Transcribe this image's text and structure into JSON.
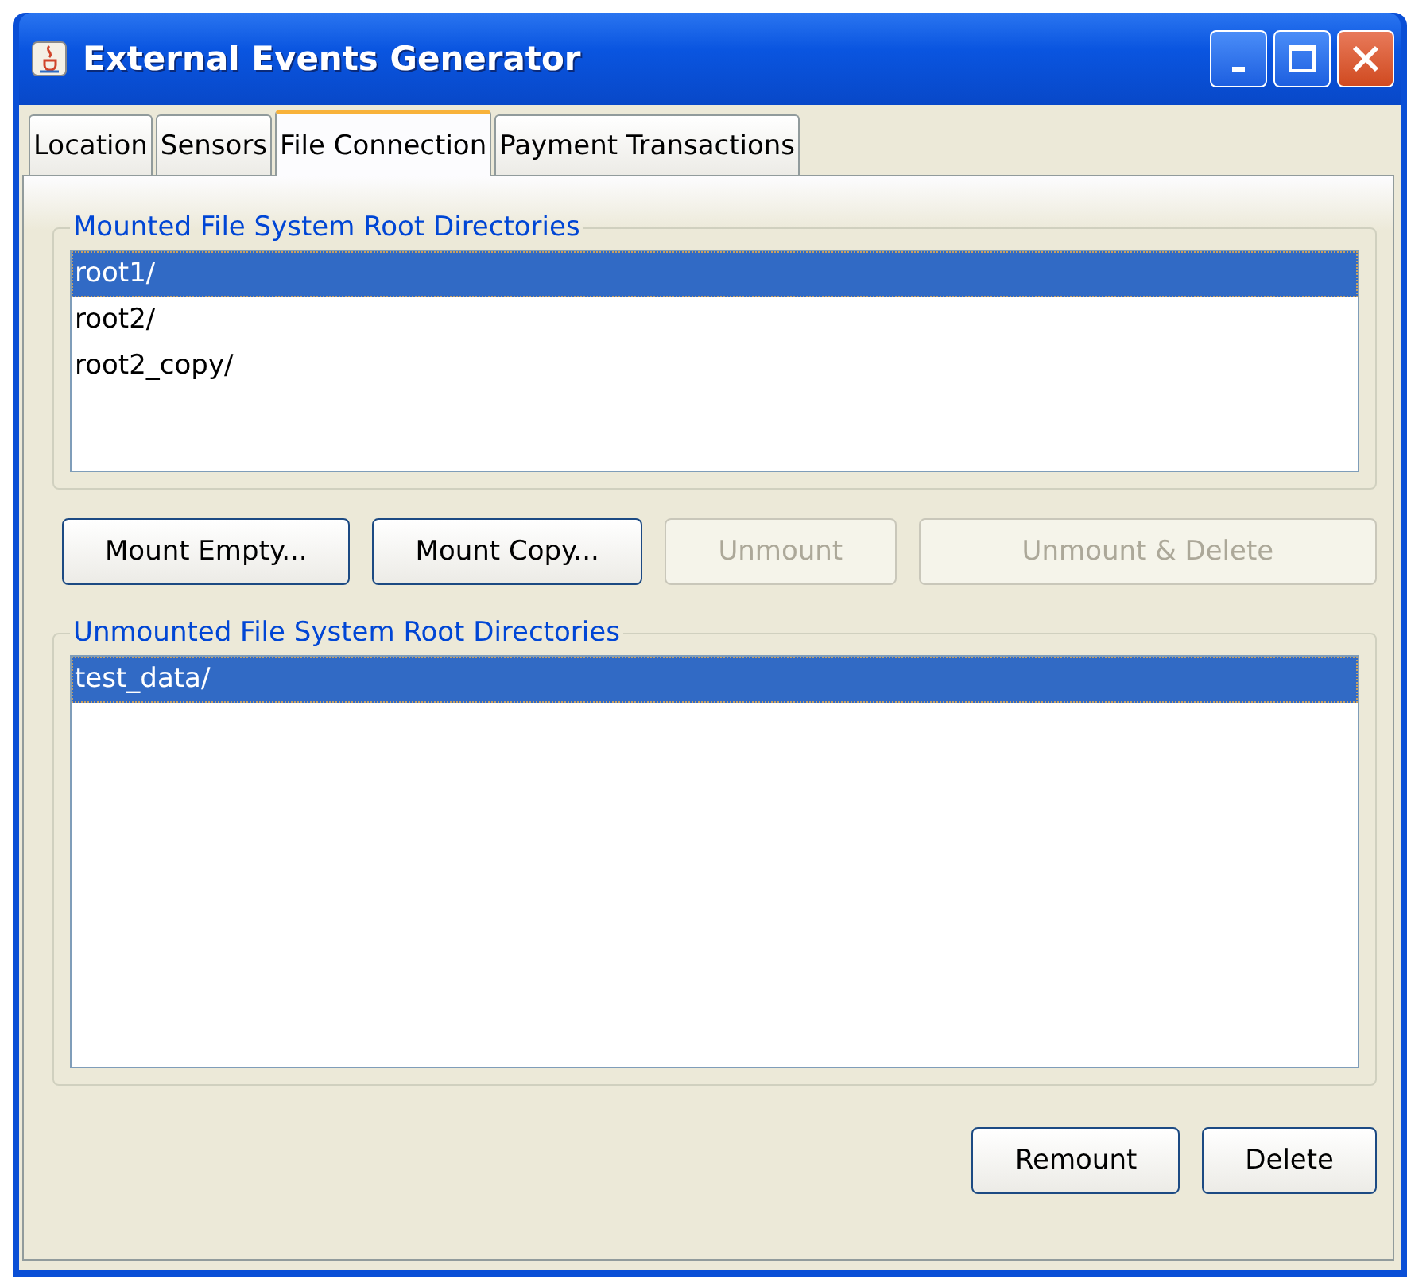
{
  "window": {
    "title": "External Events Generator"
  },
  "tabs": [
    {
      "label": "Location",
      "selected": false
    },
    {
      "label": "Sensors",
      "selected": false
    },
    {
      "label": "File Connection",
      "selected": true
    },
    {
      "label": "Payment Transactions",
      "selected": false
    }
  ],
  "mounted": {
    "title": "Mounted File System Root Directories",
    "items": [
      {
        "label": "root1/",
        "selected": true
      },
      {
        "label": "root2/",
        "selected": false
      },
      {
        "label": "root2_copy/",
        "selected": false
      }
    ]
  },
  "mount_buttons": [
    {
      "label": "Mount Empty...",
      "disabled": false
    },
    {
      "label": "Mount Copy...",
      "disabled": false
    },
    {
      "label": "Unmount",
      "disabled": true
    },
    {
      "label": "Unmount & Delete",
      "disabled": true
    }
  ],
  "unmounted": {
    "title": "Unmounted File System Root Directories",
    "items": [
      {
        "label": "test_data/",
        "selected": true
      }
    ]
  },
  "bottom_buttons": [
    {
      "label": "Remount",
      "disabled": false
    },
    {
      "label": "Delete",
      "disabled": false
    }
  ]
}
